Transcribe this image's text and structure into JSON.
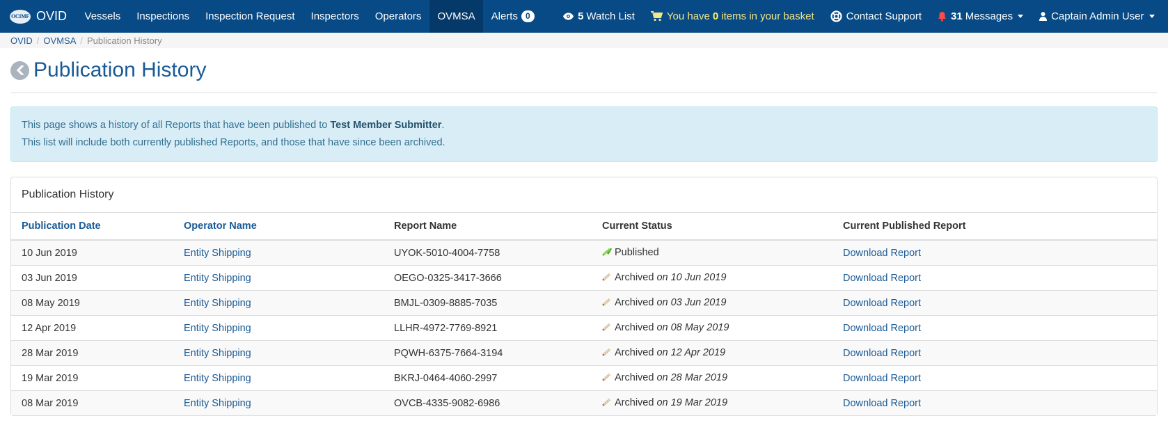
{
  "navbar": {
    "brand_logo": "OCIMF",
    "brand_name": "OVID",
    "items": [
      {
        "label": "Vessels"
      },
      {
        "label": "Inspections"
      },
      {
        "label": "Inspection Request"
      },
      {
        "label": "Inspectors"
      },
      {
        "label": "Operators"
      },
      {
        "label": "OVMSA"
      },
      {
        "label": "Alerts",
        "badge": "0"
      }
    ],
    "watch_count": "5",
    "watch_label": "Watch List",
    "basket_prefix": "You have",
    "basket_count": "0",
    "basket_suffix": "items in your basket",
    "support_label": "Contact Support",
    "messages_count": "31",
    "messages_label": "Messages",
    "user_label": "Captain Admin User",
    "colors": {
      "bar": "#074a86",
      "active": "#05396a",
      "basket": "#f3e58a"
    }
  },
  "breadcrumb": {
    "items": [
      "OVID",
      "OVMSA"
    ],
    "current": "Publication History"
  },
  "page": {
    "title": "Publication History",
    "alert_line1_prefix": "This page shows a history of all Reports that have been published to",
    "alert_line1_strong": "Test Member Submitter",
    "alert_line1_suffix": ".",
    "alert_line2": "This list will include both currently published Reports, and those that have since been archived."
  },
  "panel": {
    "heading": "Publication History",
    "columns": [
      "Publication Date",
      "Operator Name",
      "Report Name",
      "Current Status",
      "Current Published Report"
    ],
    "rows": [
      {
        "date": "10 Jun 2019",
        "operator": "Entity Shipping",
        "report": "UYOK-5010-4004-7758",
        "status": "Published",
        "status_date": "",
        "status_icon": "published-icon",
        "link": "Download Report"
      },
      {
        "date": "03 Jun 2019",
        "operator": "Entity Shipping",
        "report": "OEGO-0325-3417-3666",
        "status": "Archived",
        "status_date": "on 10 Jun 2019",
        "status_icon": "archived-icon",
        "link": "Download Report"
      },
      {
        "date": "08 May 2019",
        "operator": "Entity Shipping",
        "report": "BMJL-0309-8885-7035",
        "status": "Archived",
        "status_date": "on 03 Jun 2019",
        "status_icon": "archived-icon",
        "link": "Download Report"
      },
      {
        "date": "12 Apr 2019",
        "operator": "Entity Shipping",
        "report": "LLHR-4972-7769-8921",
        "status": "Archived",
        "status_date": "on 08 May 2019",
        "status_icon": "archived-icon",
        "link": "Download Report"
      },
      {
        "date": "28 Mar 2019",
        "operator": "Entity Shipping",
        "report": "PQWH-6375-7664-3194",
        "status": "Archived",
        "status_date": "on 12 Apr 2019",
        "status_icon": "archived-icon",
        "link": "Download Report"
      },
      {
        "date": "19 Mar 2019",
        "operator": "Entity Shipping",
        "report": "BKRJ-0464-4060-2997",
        "status": "Archived",
        "status_date": "on 28 Mar 2019",
        "status_icon": "archived-icon",
        "link": "Download Report"
      },
      {
        "date": "08 Mar 2019",
        "operator": "Entity Shipping",
        "report": "OVCB-4335-9082-6986",
        "status": "Archived",
        "status_date": "on 19 Mar 2019",
        "status_icon": "archived-icon",
        "link": "Download Report"
      }
    ]
  }
}
